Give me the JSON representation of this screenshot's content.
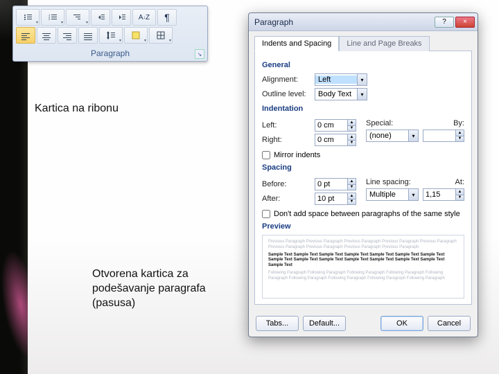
{
  "ribbon": {
    "title": "Paragraph",
    "row1": [
      {
        "name": "bullets-icon"
      },
      {
        "name": "numbering-icon"
      },
      {
        "name": "multilevel-list-icon"
      },
      {
        "name": "decrease-indent-icon"
      },
      {
        "name": "increase-indent-icon"
      },
      {
        "name": "sort-icon",
        "label": "A↓Z"
      },
      {
        "name": "pilcrow-icon",
        "label": "¶"
      }
    ],
    "row2": [
      {
        "name": "align-left-icon",
        "selected": true
      },
      {
        "name": "align-center-icon"
      },
      {
        "name": "align-right-icon"
      },
      {
        "name": "justify-icon"
      },
      {
        "name": "line-spacing-icon"
      },
      {
        "name": "shading-icon"
      },
      {
        "name": "borders-icon"
      }
    ]
  },
  "captions": {
    "ribbon": "Kartica na ribonu",
    "dialog": "Otvorena kartica za podešavanje paragrafa (pasusa)"
  },
  "dialog": {
    "title": "Paragraph",
    "help": "?",
    "close": "×",
    "tabs": {
      "indents": "Indents and Spacing",
      "breaks": "Line and Page Breaks"
    },
    "sections": {
      "general": "General",
      "indentation": "Indentation",
      "spacing": "Spacing",
      "preview": "Preview"
    },
    "labels": {
      "alignment": "Alignment:",
      "outline": "Outline level:",
      "left": "Left:",
      "right": "Right:",
      "special": "Special:",
      "by": "By:",
      "before": "Before:",
      "after": "After:",
      "linespacing": "Line spacing:",
      "at": "At:",
      "mirror": "Mirror indents",
      "noSpace": "Don't add space between paragraphs of the same style"
    },
    "values": {
      "alignment": "Left",
      "outline": "Body Text",
      "left": "0 cm",
      "right": "0 cm",
      "special": "(none)",
      "by": "",
      "before": "0 pt",
      "after": "10 pt",
      "linespacing": "Multiple",
      "at": "1,15"
    },
    "preview": {
      "prev": "Previous Paragraph Previous Paragraph Previous Paragraph Previous Paragraph Previous Paragraph Previous Paragraph Previous Paragraph Previous Paragraph Previous Paragraph",
      "sample": "Sample Text Sample Text Sample Text Sample Text Sample Text Sample Text Sample Text Sample Text Sample Text Sample Text Sample Text Sample Text Sample Text Sample Text Sample Text",
      "next": "Following Paragraph Following Paragraph Following Paragraph Following Paragraph Following Paragraph Following Paragraph Following Paragraph Following Paragraph Following Paragraph"
    },
    "buttons": {
      "tabs": "Tabs...",
      "default": "Default...",
      "ok": "OK",
      "cancel": "Cancel"
    }
  }
}
